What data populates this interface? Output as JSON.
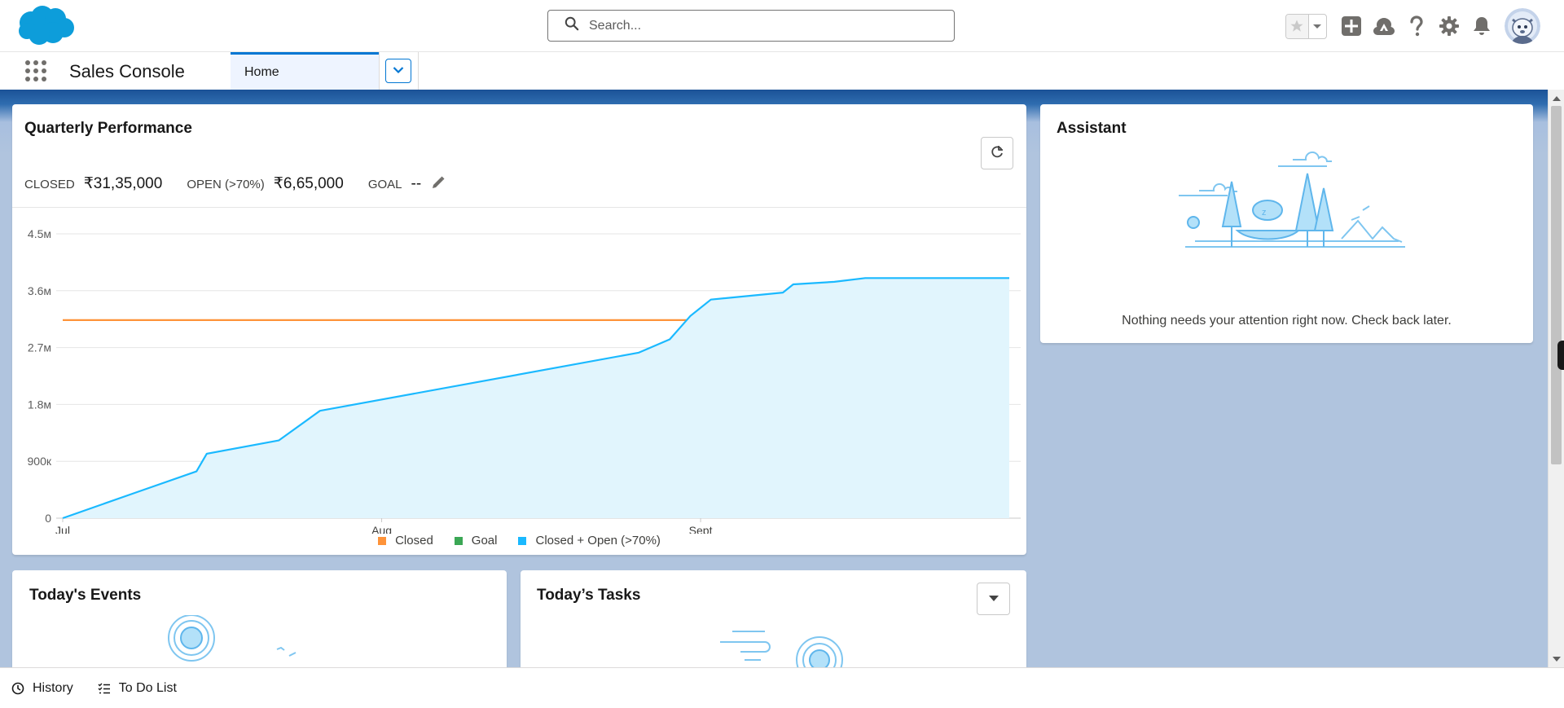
{
  "header": {
    "search_placeholder": "Search..."
  },
  "nav": {
    "app_name": "Sales Console",
    "tabs": [
      {
        "label": "Home"
      }
    ]
  },
  "performance": {
    "title": "Quarterly Performance",
    "closed_label": "CLOSED",
    "closed_value": "₹31,35,000",
    "open_label": "OPEN (>70%)",
    "open_value": "₹6,65,000",
    "goal_label": "GOAL",
    "goal_value": "--",
    "legend": [
      {
        "label": "Closed",
        "color": "#fe9339"
      },
      {
        "label": "Goal",
        "color": "#3ba755"
      },
      {
        "label": "Closed + Open (>70%)",
        "color": "#1ab9ff"
      }
    ]
  },
  "chart_data": {
    "type": "area",
    "title": "",
    "xlabel": "",
    "ylabel": "",
    "x_ticks": [
      "Jul",
      "Aug",
      "Sept"
    ],
    "y_ticks": [
      "0",
      "900к",
      "1.8м",
      "2.7м",
      "3.6м",
      "4.5м"
    ],
    "ylim": [
      0,
      4500000
    ],
    "x_domain_days": [
      0,
      92
    ],
    "grid": true,
    "legend_position": "bottom",
    "series": [
      {
        "name": "Closed",
        "type": "line",
        "color": "#fe9339",
        "points": [
          [
            0,
            3135000
          ],
          [
            92,
            3135000
          ]
        ]
      },
      {
        "name": "Closed + Open (>70%)",
        "type": "area",
        "color": "#1ab9ff",
        "fill": "#e1f5fd",
        "points": [
          [
            0,
            0
          ],
          [
            7,
            400000
          ],
          [
            13,
            740000
          ],
          [
            14,
            1020000
          ],
          [
            21,
            1230000
          ],
          [
            25,
            1700000
          ],
          [
            56,
            2620000
          ],
          [
            59,
            2830000
          ],
          [
            61,
            3200000
          ],
          [
            63,
            3460000
          ],
          [
            70,
            3570000
          ],
          [
            71,
            3700000
          ],
          [
            75,
            3740000
          ],
          [
            78,
            3800000
          ],
          [
            92,
            3800000
          ]
        ]
      }
    ]
  },
  "assistant": {
    "title": "Assistant",
    "message": "Nothing needs your attention right now. Check back later."
  },
  "events": {
    "title": "Today's Events"
  },
  "tasks": {
    "title": "Today’s Tasks"
  },
  "utility": {
    "history_label": "History",
    "todo_label": "To Do List"
  }
}
